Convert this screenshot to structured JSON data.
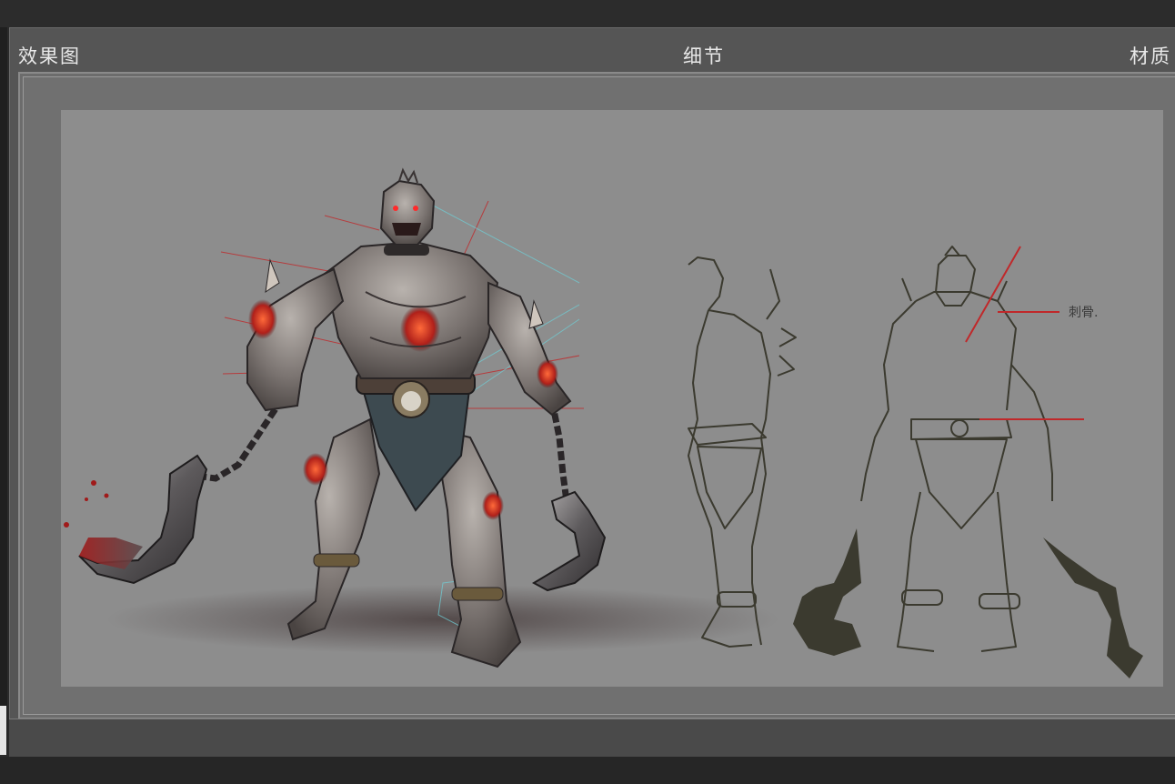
{
  "panel": {
    "headers": {
      "left": "效果图",
      "center": "细节",
      "right": "材质"
    }
  },
  "artwork": {
    "subject": "concept-art-chained-brute",
    "annotation_label": "刺骨."
  },
  "colors": {
    "background": "#2b2b2b",
    "panel": "#555555",
    "canvas": "#8d8d8d",
    "sketch_ink": "#3b3a2f",
    "annotation_red": "#c0282a",
    "annotation_cyan": "#6fd0d8",
    "glow_red": "#e0402a"
  }
}
